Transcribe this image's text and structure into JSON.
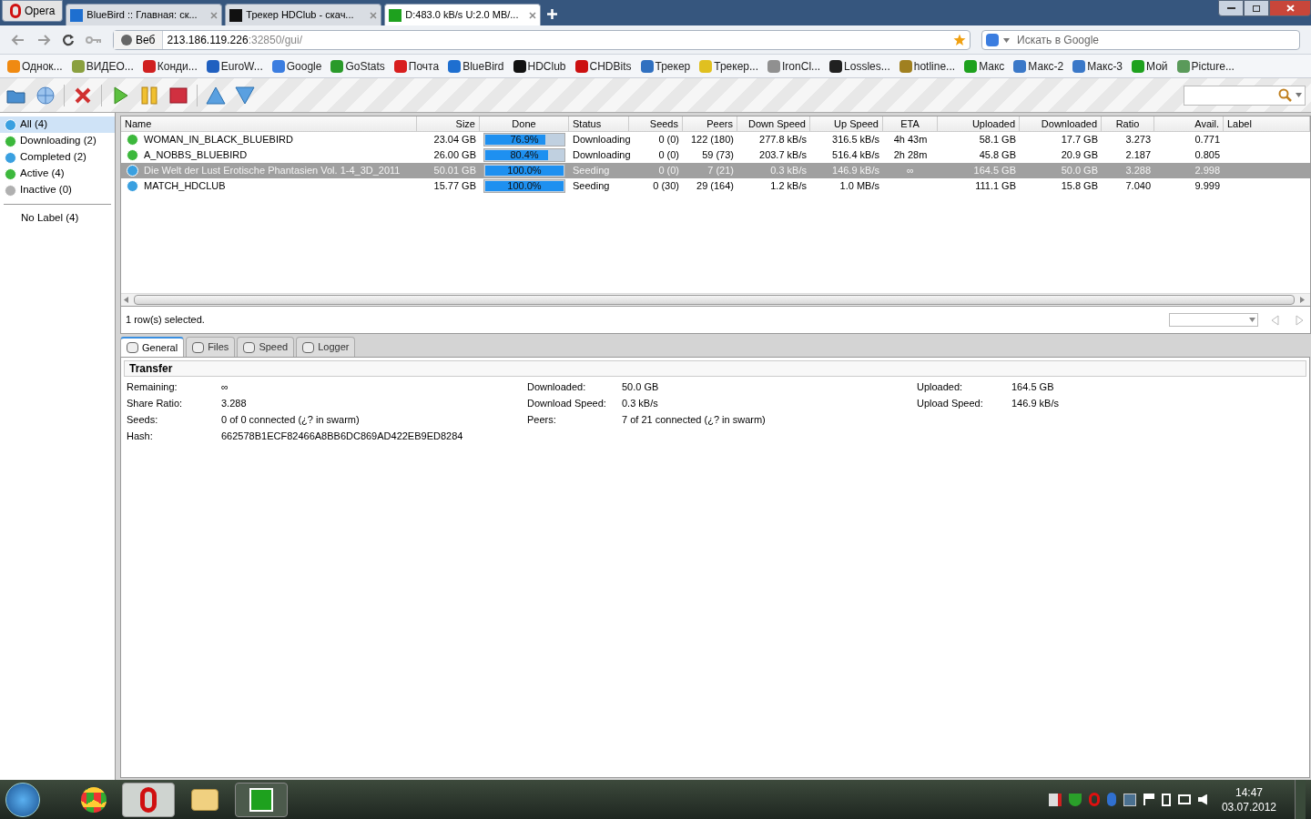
{
  "browser": {
    "menu_button": "Opera",
    "tabs": [
      {
        "label": "BlueBird :: Главная: ск...",
        "selected": false,
        "color": "#1e6fd0"
      },
      {
        "label": "Трекер HDClub - скач...",
        "selected": false,
        "color": "#111111"
      },
      {
        "label": "D:483.0 kB/s U:2.0 MB/...",
        "selected": true,
        "color": "#1ea11e"
      }
    ],
    "address": {
      "prefix": "Веб",
      "host": "213.186.119.226",
      "path": ":32850/gui/"
    },
    "search": {
      "placeholder": "Искать в Google"
    },
    "bookmarks": [
      {
        "label": "Однок...",
        "color": "#f08a12"
      },
      {
        "label": "ВИДЕО...",
        "color": "#8aa040"
      },
      {
        "label": "Конди...",
        "color": "#d02020"
      },
      {
        "label": "EuroW...",
        "color": "#2060c0"
      },
      {
        "label": "Google",
        "color": "#3b7de0"
      },
      {
        "label": "GoStats",
        "color": "#2a9a2a"
      },
      {
        "label": "Почта",
        "color": "#d81e1e"
      },
      {
        "label": "BlueBird",
        "color": "#1e6fd0"
      },
      {
        "label": "HDClub",
        "color": "#111111"
      },
      {
        "label": "CHDBits",
        "color": "#cc1010"
      },
      {
        "label": "Трекер",
        "color": "#3070c0"
      },
      {
        "label": "Трекер...",
        "color": "#e0c020"
      },
      {
        "label": "IronCl...",
        "color": "#909090"
      },
      {
        "label": "Lossles...",
        "color": "#202020"
      },
      {
        "label": "hotline...",
        "color": "#a08020"
      },
      {
        "label": "Макс",
        "color": "#1ea11e"
      },
      {
        "label": "Макс-2",
        "color": "#3a78c8"
      },
      {
        "label": "Макс-3",
        "color": "#3a78c8"
      },
      {
        "label": "Мой",
        "color": "#1ea11e"
      },
      {
        "label": "Picture...",
        "color": "#5a9a5a"
      }
    ]
  },
  "sidebar": {
    "items": [
      {
        "label": "All (4)",
        "selected": true,
        "color": "#3aa0e0"
      },
      {
        "label": "Downloading (2)",
        "selected": false,
        "color": "#3cb83c"
      },
      {
        "label": "Completed (2)",
        "selected": false,
        "color": "#3aa0e0"
      },
      {
        "label": "Active (4)",
        "selected": false,
        "color": "#3cb83c"
      },
      {
        "label": "Inactive (0)",
        "selected": false,
        "color": "#b0b0b0"
      }
    ],
    "labels": [
      {
        "label": "No Label (4)",
        "selected": false
      }
    ]
  },
  "table": {
    "columns": [
      "Name",
      "Size",
      "Done",
      "Status",
      "Seeds",
      "Peers",
      "Down Speed",
      "Up Speed",
      "ETA",
      "Uploaded",
      "Downloaded",
      "Ratio",
      "Avail.",
      "Label"
    ],
    "rows": [
      {
        "kind": "downloading",
        "selected": false,
        "name": "WOMAN_IN_BLACK_BLUEBIRD",
        "size": "23.04 GB",
        "done": "76.9%",
        "level": 0.769,
        "status": "Downloading",
        "seeds": "0 (0)",
        "peers": "122 (180)",
        "down": "277.8 kB/s",
        "up": "316.5 kB/s",
        "eta": "4h 43m",
        "uploaded": "58.1 GB",
        "downloaded": "17.7 GB",
        "ratio": "3.273",
        "avail": "0.771"
      },
      {
        "kind": "downloading",
        "selected": false,
        "name": "A_NOBBS_BLUEBIRD",
        "size": "26.00 GB",
        "done": "80.4%",
        "level": 0.804,
        "status": "Downloading",
        "seeds": "0 (0)",
        "peers": "59 (73)",
        "down": "203.7 kB/s",
        "up": "516.4 kB/s",
        "eta": "2h 28m",
        "uploaded": "45.8 GB",
        "downloaded": "20.9 GB",
        "ratio": "2.187",
        "avail": "0.805"
      },
      {
        "kind": "seeding",
        "selected": true,
        "name": "Die Welt der Lust Erotische Phantasien Vol. 1-4_3D_2011",
        "size": "50.01 GB",
        "done": "100.0%",
        "level": 1,
        "status": "Seeding",
        "seeds": "0 (0)",
        "peers": "7 (21)",
        "down": "0.3 kB/s",
        "up": "146.9 kB/s",
        "eta": "∞",
        "uploaded": "164.5 GB",
        "downloaded": "50.0 GB",
        "ratio": "3.288",
        "avail": "2.998"
      },
      {
        "kind": "seeding",
        "selected": false,
        "name": "MATCH_HDCLUB",
        "size": "15.77 GB",
        "done": "100.0%",
        "level": 1,
        "status": "Seeding",
        "seeds": "0 (30)",
        "peers": "29 (164)",
        "down": "1.2 kB/s",
        "up": "1.0 MB/s",
        "uploaded": "111.1 GB",
        "downloaded": "15.8 GB",
        "ratio": "7.040",
        "avail": "9.999"
      }
    ]
  },
  "status_text": "1 row(s) selected.",
  "detail_tabs": [
    {
      "label": "General",
      "selected": true
    },
    {
      "label": "Files",
      "selected": false
    },
    {
      "label": "Speed",
      "selected": false
    },
    {
      "label": "Logger",
      "selected": false
    }
  ],
  "transfer": {
    "title": "Transfer",
    "columns": [
      [
        {
          "label": "Remaining:",
          "value": "∞"
        },
        {
          "label": "Share Ratio:",
          "value": "3.288"
        },
        {
          "label": "Seeds:",
          "value": "0 of 0 connected (¿? in swarm)"
        },
        {
          "label": "Hash:",
          "value": "662578B1ECF82466A8BB6DC869AD422EB9ED8284"
        }
      ],
      [
        {
          "label": "Downloaded:",
          "value": "50.0 GB"
        },
        {
          "label": "Download Speed:",
          "value": "0.3 kB/s"
        },
        {
          "label": "Peers:",
          "value": "7 of 21 connected (¿? in swarm)"
        }
      ],
      [
        {
          "label": "Uploaded:",
          "value": "164.5 GB"
        },
        {
          "label": "Upload Speed:",
          "value": "146.9 kB/s"
        }
      ]
    ]
  },
  "taskbar": {
    "time": "14:47",
    "date": "03.07.2012"
  }
}
